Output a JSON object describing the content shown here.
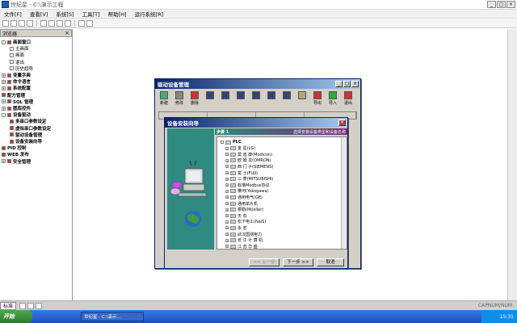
{
  "window": {
    "title": "世纪星 - C:\\演示工程"
  },
  "menu": [
    "文件[F]",
    "查看[V]",
    "系统[S]",
    "工具[T]",
    "帮助[H]",
    "运行系统[R]"
  ],
  "left_panel": {
    "title": "浏览器",
    "items": [
      {
        "label": "画面窗口",
        "bold": true,
        "expander": "-"
      },
      {
        "label": "主画面",
        "indent": 2
      },
      {
        "label": "画面",
        "indent": 2
      },
      {
        "label": "退出",
        "indent": 2
      },
      {
        "label": "历史趋势",
        "indent": 2
      },
      {
        "label": "变量字典",
        "bold": true,
        "expander": "+"
      },
      {
        "label": "命令语言",
        "bold": true,
        "expander": "+"
      },
      {
        "label": "系统配置",
        "bold": true,
        "expander": "+"
      },
      {
        "label": "配方管理",
        "bold": true
      },
      {
        "label": "SQL 管理",
        "bold": true,
        "expander": "+"
      },
      {
        "label": "图库控件",
        "bold": true,
        "expander": "+"
      },
      {
        "label": "设备驱动",
        "bold": true,
        "expander": "-"
      },
      {
        "label": "多串口参数设定",
        "indent": 2,
        "bold": true
      },
      {
        "label": "虚拟串口参数设定",
        "indent": 2,
        "bold": true
      },
      {
        "label": "驱动设备管理",
        "indent": 2,
        "bold": true
      },
      {
        "label": "设备安装向导",
        "indent": 2,
        "bold": true
      },
      {
        "label": "PID 控制",
        "bold": true
      },
      {
        "label": "WEB 发布",
        "bold": true
      },
      {
        "label": "安全管理",
        "bold": true,
        "expander": "+"
      }
    ]
  },
  "dialog_device_mgr": {
    "title": "驱动设备管理",
    "tools": [
      "新建",
      "修改",
      "删除",
      "",
      "",
      "",
      "",
      "",
      "",
      "",
      "导出",
      "导入",
      "退出"
    ]
  },
  "dialog_wizard": {
    "title": "设备安装向导",
    "step_label": "步骤 1",
    "step_text": "选择安装设备类型和设备名称",
    "list": [
      {
        "label": "PLC",
        "bold": true,
        "expander": "-",
        "indent": 0
      },
      {
        "label": "金    星(LG)",
        "expander": "+",
        "indent": 1
      },
      {
        "label": "莫 迪 康(Modicon)",
        "expander": "+",
        "indent": 1
      },
      {
        "label": "欧 姆 龙(OMRON)",
        "expander": "+",
        "indent": 1
      },
      {
        "label": "西 门 子(SIEMENS)",
        "expander": "+",
        "indent": 1
      },
      {
        "label": "富    士(FUJI)",
        "expander": "+",
        "indent": 1
      },
      {
        "label": "三    菱(MITSUBISHI)",
        "expander": "+",
        "indent": 1
      },
      {
        "label": "标准Modbus协议",
        "expander": "+",
        "indent": 1
      },
      {
        "label": "横河(Yokogawa)",
        "expander": "+",
        "indent": 1
      },
      {
        "label": "通用电气(GE)",
        "expander": "+",
        "indent": 1
      },
      {
        "label": "通用单片机",
        "expander": "+",
        "indent": 1
      },
      {
        "label": "穆勒(Moeller)",
        "expander": "+",
        "indent": 1
      },
      {
        "label": "天    石",
        "expander": "+",
        "indent": 1
      },
      {
        "label": "松下电工(NaiS)",
        "expander": "+",
        "indent": 1
      },
      {
        "label": "永    宏",
        "expander": "+",
        "indent": 1
      },
      {
        "label": "武汉国测电力",
        "expander": "+",
        "indent": 1
      },
      {
        "label": "长 江 计 算 机",
        "expander": "+",
        "indent": 1
      },
      {
        "label": "江 苏 华 盛",
        "expander": "+",
        "indent": 1
      }
    ],
    "buttons": {
      "back": "<< 上一步",
      "next": "下一步 >>",
      "cancel": "取消"
    }
  },
  "bottom_tabs": [
    "标准"
  ],
  "status": {
    "caps": "CAPNUM/NUM"
  },
  "taskbar": {
    "start": "开始",
    "app": "世纪星 - C:\\演示...",
    "time": "15:31"
  }
}
